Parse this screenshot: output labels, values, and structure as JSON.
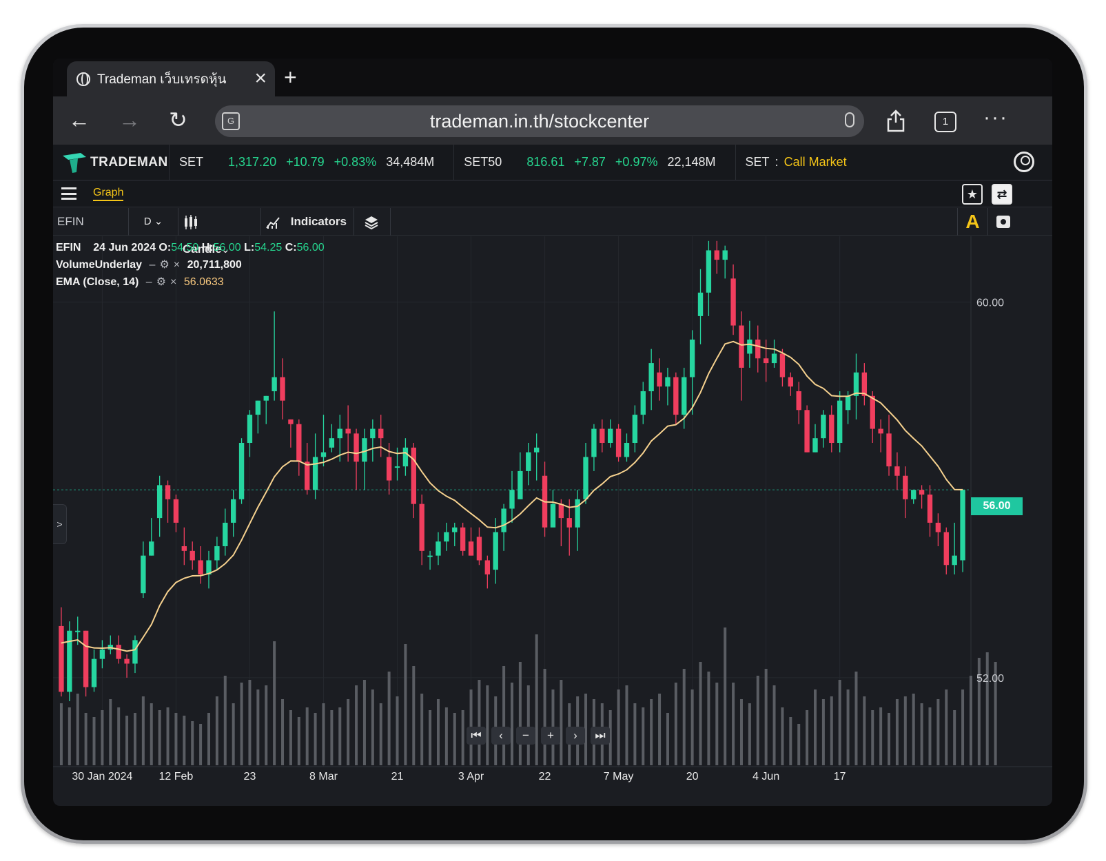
{
  "browser": {
    "tab_title": "Trademan เว็บเทรดหุ้น",
    "new_tab_symbol": "+",
    "url": "trademan.in.th/stockcenter",
    "tab_count": "1"
  },
  "market_bar": {
    "brand": "TRADEMAN",
    "set": {
      "name": "SET",
      "value": "1,317.20",
      "change": "+10.79",
      "percent": "+0.83%",
      "volume": "34,484M"
    },
    "set50": {
      "name": "SET50",
      "value": "816.61",
      "change": "+7.87",
      "percent": "+0.97%",
      "volume": "22,148M"
    },
    "status": {
      "name": "SET",
      "separator": ":",
      "value": "Call Market"
    }
  },
  "menu": {
    "graph_tab": "Graph"
  },
  "chart_toolbar": {
    "symbol": "EFIN",
    "interval": "D",
    "chart_type": "Candle",
    "indicators": "Indicators",
    "a_button": "A"
  },
  "legend": {
    "symbol": "EFIN",
    "date": "24 Jun 2024",
    "o_label": "O:",
    "o": "54.50",
    "h_label": "H:",
    "h": "56.00",
    "l_label": "L:",
    "l": "54.25",
    "c_label": "C:",
    "c": "56.00",
    "volume_name": "VolumeUnderlay",
    "volume_value": "20,711,800",
    "ema_name": "EMA (Close, 14)",
    "ema_value": "56.0633"
  },
  "colors": {
    "up": "#26d6a0",
    "down": "#f03e5e",
    "ema": "#f7d28f",
    "accent": "#f5c518",
    "price_tag": "#1fc7a0"
  },
  "chart_data": {
    "type": "candlestick",
    "symbol": "EFIN",
    "y_ticks": [
      60.0,
      52.0
    ],
    "y_tick_labels": [
      "60.00",
      "52.00"
    ],
    "current_price": 56.0,
    "current_price_label": "56.00",
    "x_tick_labels": [
      "30 Jan 2024",
      "12 Feb",
      "23",
      "8 Mar",
      "21",
      "3 Apr",
      "22",
      "7 May",
      "20",
      "4 Jun",
      "17"
    ],
    "x_tick_index": [
      5,
      14,
      23,
      32,
      41,
      50,
      59,
      68,
      77,
      86,
      95
    ],
    "ylim": [
      50.4,
      61.4
    ],
    "candles": [
      [
        53.1,
        51.7,
        53.5,
        51.6
      ],
      [
        51.7,
        53.0,
        53.2,
        51.5
      ],
      [
        53.0,
        53.0,
        53.3,
        52.7
      ],
      [
        53.0,
        51.8,
        53.0,
        51.6
      ],
      [
        51.8,
        52.4,
        52.6,
        51.7
      ],
      [
        52.4,
        52.6,
        52.8,
        52.2
      ],
      [
        52.6,
        52.7,
        52.9,
        52.5
      ],
      [
        52.7,
        52.4,
        52.9,
        52.3
      ],
      [
        52.4,
        52.3,
        52.5,
        52.0
      ],
      [
        52.3,
        52.8,
        52.9,
        52.1
      ],
      [
        53.8,
        54.6,
        54.9,
        53.7
      ],
      [
        54.6,
        54.9,
        55.4,
        54.6
      ],
      [
        55.4,
        56.1,
        56.3,
        55.0
      ],
      [
        56.1,
        55.8,
        56.2,
        55.3
      ],
      [
        55.8,
        55.3,
        55.9,
        55.1
      ],
      [
        54.8,
        54.7,
        55.2,
        54.4
      ],
      [
        54.7,
        54.5,
        54.9,
        54.3
      ],
      [
        54.5,
        54.2,
        54.8,
        54.0
      ],
      [
        54.2,
        54.5,
        54.7,
        53.9
      ],
      [
        54.5,
        54.8,
        55.0,
        54.3
      ],
      [
        54.8,
        55.3,
        55.6,
        54.6
      ],
      [
        55.3,
        55.8,
        56.0,
        55.0
      ],
      [
        55.8,
        57.0,
        57.1,
        55.7
      ],
      [
        57.0,
        57.6,
        57.7,
        56.7
      ],
      [
        57.6,
        57.9,
        57.9,
        57.2
      ],
      [
        57.9,
        58.0,
        58.0,
        57.4
      ],
      [
        58.1,
        58.4,
        59.8,
        57.9
      ],
      [
        58.4,
        57.9,
        58.8,
        57.5
      ],
      [
        57.5,
        57.4,
        57.5,
        56.9
      ],
      [
        57.4,
        56.6,
        57.5,
        56.3
      ],
      [
        56.6,
        56.0,
        57.0,
        55.9
      ],
      [
        56.0,
        56.7,
        57.2,
        55.8
      ],
      [
        56.7,
        56.8,
        57.6,
        56.5
      ],
      [
        56.9,
        57.1,
        57.4,
        56.8
      ],
      [
        57.1,
        57.3,
        57.6,
        56.6
      ],
      [
        57.3,
        57.2,
        57.8,
        56.6
      ],
      [
        57.2,
        56.6,
        57.3,
        56.0
      ],
      [
        56.6,
        57.1,
        57.3,
        56.0
      ],
      [
        57.1,
        57.3,
        57.5,
        56.6
      ],
      [
        57.3,
        57.1,
        57.6,
        56.7
      ],
      [
        56.7,
        56.2,
        57.0,
        55.9
      ],
      [
        56.5,
        56.5,
        56.9,
        56.2
      ],
      [
        56.5,
        56.9,
        57.1,
        56.3
      ],
      [
        56.9,
        55.7,
        57.0,
        55.4
      ],
      [
        55.7,
        54.7,
        55.9,
        54.4
      ],
      [
        54.6,
        54.6,
        54.7,
        54.3
      ],
      [
        54.6,
        54.9,
        55.1,
        54.4
      ],
      [
        54.9,
        55.1,
        55.3,
        54.7
      ],
      [
        55.1,
        55.2,
        55.3,
        54.8
      ],
      [
        55.2,
        54.7,
        55.3,
        54.6
      ],
      [
        54.9,
        54.6,
        55.2,
        54.6
      ],
      [
        55.0,
        54.5,
        55.2,
        54.4
      ],
      [
        54.5,
        54.2,
        54.6,
        53.9
      ],
      [
        54.3,
        55.1,
        55.4,
        54.0
      ],
      [
        55.1,
        55.6,
        55.7,
        54.7
      ],
      [
        55.6,
        56.0,
        56.4,
        55.3
      ],
      [
        55.8,
        56.4,
        56.8,
        55.8
      ],
      [
        56.4,
        56.8,
        57.0,
        56.1
      ],
      [
        56.8,
        56.9,
        57.2,
        56.2
      ],
      [
        56.3,
        55.2,
        56.6,
        55.0
      ],
      [
        55.2,
        55.7,
        56.0,
        55.3
      ],
      [
        55.7,
        55.4,
        55.8,
        54.8
      ],
      [
        55.4,
        55.2,
        55.8,
        54.6
      ],
      [
        55.2,
        55.8,
        56.0,
        54.7
      ],
      [
        55.8,
        56.7,
        57.0,
        55.7
      ],
      [
        56.7,
        57.3,
        57.4,
        56.4
      ],
      [
        57.3,
        57.0,
        57.5,
        56.8
      ],
      [
        57.0,
        57.3,
        57.5,
        56.9
      ],
      [
        57.3,
        56.7,
        57.4,
        56.6
      ],
      [
        56.7,
        57.0,
        57.2,
        56.6
      ],
      [
        57.0,
        57.6,
        57.8,
        56.8
      ],
      [
        57.6,
        58.1,
        58.3,
        57.4
      ],
      [
        58.1,
        58.7,
        59.0,
        57.7
      ],
      [
        58.5,
        58.2,
        58.8,
        57.9
      ],
      [
        58.2,
        58.4,
        58.6,
        57.8
      ],
      [
        58.4,
        57.6,
        58.5,
        57.4
      ],
      [
        57.6,
        58.4,
        58.6,
        57.3
      ],
      [
        58.4,
        59.2,
        59.4,
        57.6
      ],
      [
        59.7,
        60.2,
        60.7,
        59.1
      ],
      [
        60.2,
        61.1,
        61.3,
        59.7
      ],
      [
        61.1,
        60.9,
        61.3,
        60.6
      ],
      [
        60.9,
        61.1,
        61.2,
        60.5
      ],
      [
        60.5,
        59.5,
        60.8,
        59.3
      ],
      [
        59.5,
        58.6,
        59.8,
        57.9
      ],
      [
        58.9,
        59.2,
        59.6,
        58.6
      ],
      [
        59.2,
        58.8,
        59.5,
        58.5
      ],
      [
        58.8,
        58.7,
        59.2,
        58.3
      ],
      [
        58.7,
        58.9,
        59.2,
        58.6
      ],
      [
        58.9,
        58.4,
        59.0,
        58.2
      ],
      [
        58.4,
        58.2,
        58.5,
        58.0
      ],
      [
        58.1,
        57.7,
        58.3,
        57.4
      ],
      [
        57.7,
        56.8,
        57.8,
        56.8
      ],
      [
        56.8,
        57.1,
        57.4,
        56.8
      ],
      [
        57.1,
        57.6,
        57.7,
        56.9
      ],
      [
        57.6,
        57.0,
        57.8,
        56.8
      ],
      [
        57.0,
        57.9,
        58.1,
        56.8
      ],
      [
        57.7,
        58.0,
        58.1,
        57.4
      ],
      [
        58.0,
        58.5,
        58.9,
        57.5
      ],
      [
        58.5,
        58.0,
        58.7,
        57.8
      ],
      [
        58.0,
        57.3,
        58.1,
        57.0
      ],
      [
        57.3,
        57.2,
        57.5,
        56.8
      ],
      [
        57.2,
        56.5,
        57.6,
        56.3
      ],
      [
        56.5,
        56.3,
        56.8,
        56.0
      ],
      [
        56.3,
        55.8,
        56.5,
        55.4
      ],
      [
        55.8,
        56.0,
        56.0,
        55.7
      ],
      [
        56.0,
        55.9,
        56.1,
        55.6
      ],
      [
        55.9,
        55.3,
        56.1,
        55.0
      ],
      [
        55.3,
        55.1,
        55.5,
        54.8
      ],
      [
        55.1,
        54.4,
        55.2,
        54.2
      ],
      [
        54.4,
        54.6,
        55.3,
        54.2
      ],
      [
        54.5,
        56.0,
        56.0,
        54.25
      ]
    ],
    "volume_relative": [
      0.45,
      0.42,
      0.52,
      0.38,
      0.35,
      0.4,
      0.48,
      0.42,
      0.36,
      0.38,
      0.5,
      0.45,
      0.4,
      0.42,
      0.38,
      0.36,
      0.32,
      0.3,
      0.38,
      0.5,
      0.65,
      0.45,
      0.6,
      0.62,
      0.55,
      0.58,
      0.9,
      0.48,
      0.4,
      0.35,
      0.42,
      0.38,
      0.45,
      0.4,
      0.42,
      0.48,
      0.58,
      0.62,
      0.55,
      0.45,
      0.68,
      0.5,
      0.88,
      0.72,
      0.52,
      0.4,
      0.48,
      0.42,
      0.38,
      0.4,
      0.55,
      0.62,
      0.58,
      0.5,
      0.72,
      0.6,
      0.75,
      0.58,
      0.95,
      0.7,
      0.55,
      0.62,
      0.45,
      0.5,
      0.52,
      0.48,
      0.45,
      0.4,
      0.55,
      0.58,
      0.45,
      0.42,
      0.48,
      0.52,
      0.38,
      0.6,
      0.7,
      0.55,
      0.75,
      0.68,
      0.6,
      1.0,
      0.6,
      0.48,
      0.45,
      0.65,
      0.7,
      0.58,
      0.42,
      0.35,
      0.3,
      0.4,
      0.55,
      0.48,
      0.5,
      0.62,
      0.55,
      0.68,
      0.5,
      0.4,
      0.42,
      0.38,
      0.48,
      0.5,
      0.52,
      0.45,
      0.42,
      0.48,
      0.55,
      0.4,
      0.55,
      0.65,
      0.78,
      0.82,
      0.75
    ]
  }
}
